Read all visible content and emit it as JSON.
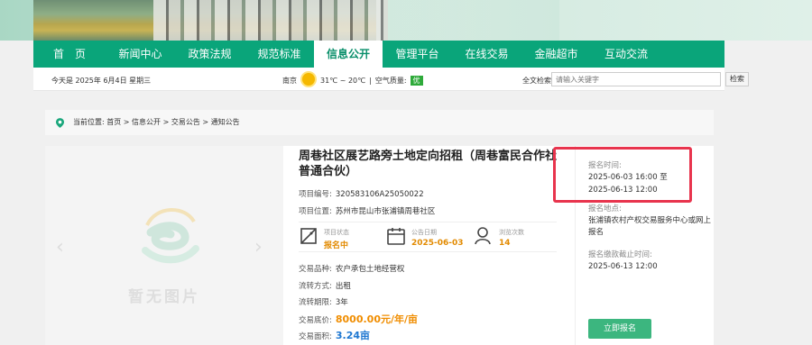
{
  "nav": {
    "items": [
      "首　页",
      "新闻中心",
      "政策法规",
      "规范标准",
      "信息公开",
      "管理平台",
      "在线交易",
      "金融超市",
      "互动交流"
    ],
    "active_index": 4
  },
  "infobar": {
    "date": "今天是 2025年 6月4日 星期三",
    "city": "南京",
    "temp": "31℃ ~ 20℃",
    "aqi_label": "空气质量:",
    "aqi_value": "优",
    "search_label": "全文检索",
    "search_placeholder": "请输入关键字",
    "search_button": "检索"
  },
  "breadcrumb": "当前位置:  首页 > 信息公开 > 交易公告 > 通知公告",
  "image": {
    "placeholder_text": "暂无图片",
    "prev": "‹",
    "next": "›"
  },
  "project": {
    "title": "周巷社区展艺路旁土地定向招租（周巷富民合作社普通合伙）",
    "code_label": "项目编号:",
    "code": "320583106A25050022",
    "location_label": "项目位置:",
    "location": "苏州市昆山市张浦镇周巷社区",
    "stats": [
      {
        "label": "项目状态",
        "value": "报名中"
      },
      {
        "label": "公告日期",
        "value": "2025-06-03"
      },
      {
        "label": "浏览次数",
        "value": "14"
      }
    ],
    "variety_label": "交易品种:",
    "variety": "农户承包土地经营权",
    "method_label": "流转方式:",
    "method": "出租",
    "term_label": "流转期限:",
    "term": "3年",
    "price_label": "交易底价:",
    "price": "8000.00元/年/亩",
    "area_label": "交易面积:",
    "area": "3.24亩"
  },
  "side": {
    "reg_time_label": "报名时间:",
    "reg_time_start": "2025-06-03 16:00  至",
    "reg_time_end": "2025-06-13 12:00",
    "reg_place_label": "报名地点:",
    "reg_place": "张浦镇农村产权交易服务中心或网上报名",
    "deposit_label": "报名缴款截止时间:",
    "deposit_time": "2025-06-13 12:00",
    "apply_button": "立即报名"
  },
  "colors": {
    "nav_bg": "#0aa57a",
    "price": "#f08d00",
    "area": "#1e77d1",
    "highlight_box": "#e8344d",
    "apply_button": "#3cb67f"
  }
}
